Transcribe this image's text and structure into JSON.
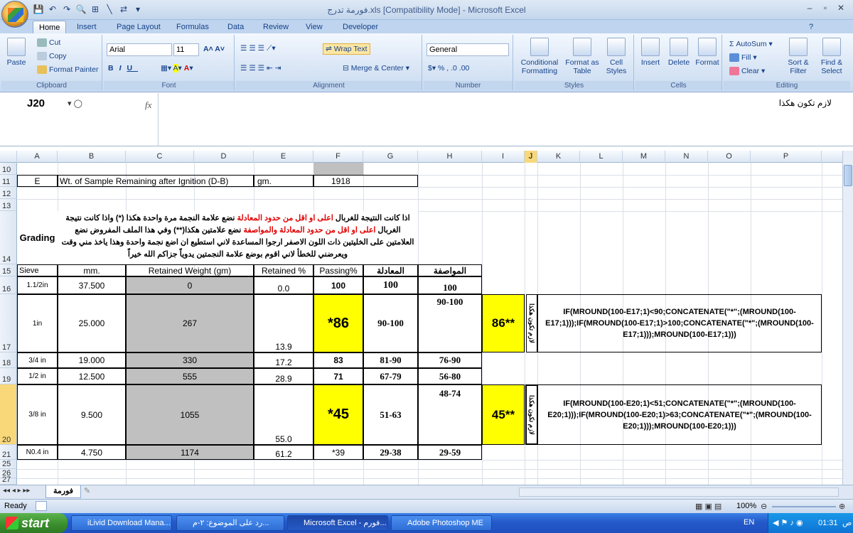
{
  "window": {
    "title": "فورمة تدرج.xls  [Compatibility Mode] - Microsoft Excel",
    "min": "–",
    "max": "▫",
    "close": "✕"
  },
  "ribbon_tabs": [
    "Home",
    "Insert",
    "Page Layout",
    "Formulas",
    "Data",
    "Review",
    "View",
    "Developer"
  ],
  "ribbon": {
    "clipboard": {
      "paste": "Paste",
      "cut": "Cut",
      "copy": "Copy",
      "format_painter": "Format Painter",
      "label": "Clipboard"
    },
    "font": {
      "name": "Arial",
      "size": "11",
      "label": "Font"
    },
    "alignment": {
      "wrap": "Wrap Text",
      "merge": "Merge & Center",
      "label": "Alignment"
    },
    "number": {
      "format": "General",
      "label": "Number"
    },
    "styles": {
      "conditional": "Conditional Formatting",
      "format_table": "Format as Table",
      "cell_styles": "Cell Styles",
      "label": "Styles"
    },
    "cells": {
      "insert": "Insert",
      "delete": "Delete",
      "format": "Format",
      "label": "Cells"
    },
    "editing": {
      "autosum": "AutoSum",
      "fill": "Fill",
      "clear": "Clear",
      "sort": "Sort & Filter",
      "find": "Find & Select",
      "label": "Editing"
    }
  },
  "formula_bar": {
    "name_box": "J20",
    "fx": "fx",
    "value": "لازم تكون هكذا"
  },
  "columns": [
    "A",
    "B",
    "C",
    "D",
    "E",
    "F",
    "G",
    "H",
    "I",
    "J",
    "K",
    "L",
    "M",
    "N",
    "O",
    "P"
  ],
  "rows": {
    "r11": {
      "a": "E",
      "b": "Wt. of Sample Remaining after Ignition (D-B)",
      "e": "gm.",
      "f": "1918"
    },
    "r14": {
      "grading": "Grading",
      "note_part1": "اذا كانت النتيجة للغربال ",
      "note_red1": "اعلى او اقل من حدود المعادلة",
      "note_part2": " نضع علامة النجمة مرة واحدة هكذا (*) واذا كانت نتيجة الغربال ",
      "note_red2": "اعلى او اقل من حدود المعادلة والمواصفة",
      "note_part3": " نضع علامتين هكذا(**)  وفي هذا الملف المفروض نضع العلامتين على الخليتين ذات اللون الاصفر ارجوا المساعدة لاني استطيع ان اضع نجمة واحدة وهذا ياخذ مني وقت ويعرضني للخطأ لاني اقوم بوضع علامة النجمتين يدوياً جزاكم الله خيراً"
    },
    "r15": {
      "sieve": "Sieve",
      "mm": "mm.",
      "retained_wt": "Retained Weight (gm)",
      "retained_pct": "Retained %",
      "passing": "Passing%",
      "equation": "المعادلة",
      "spec": "المواصفة"
    },
    "data": [
      {
        "row": "16",
        "sieve": "1.1/2in",
        "mm": "37.500",
        "wt": "0",
        "pct": "0.0",
        "pass": "100",
        "eq": "100",
        "spec": "100"
      },
      {
        "row": "17",
        "sieve": "1in",
        "mm": "25.000",
        "wt": "267",
        "pct": "13.9",
        "pass": "*86",
        "eq": "90-100",
        "spec": "90-100",
        "i": "86**",
        "j": "لازم تكون هكذا",
        "formula": "IF(MROUND(100-E17;1)<90;CONCATENATE(\"*\";(MROUND(100-E17;1)));IF(MROUND(100-E17;1)>100;CONCATENATE(\"*\";(MROUND(100-E17;1)));MROUND(100-E17;1)))"
      },
      {
        "row": "18",
        "sieve": "3/4 in",
        "mm": "19.000",
        "wt": "330",
        "pct": "17.2",
        "pass": "83",
        "eq": "81-90",
        "spec": "76-90"
      },
      {
        "row": "19",
        "sieve": "1/2 in",
        "mm": "12.500",
        "wt": "555",
        "pct": "28.9",
        "pass": "71",
        "eq": "67-79",
        "spec": "56-80"
      },
      {
        "row": "20",
        "sieve": "3/8 in",
        "mm": "9.500",
        "wt": "1055",
        "pct": "55.0",
        "pass": "*45",
        "eq": "51-63",
        "spec": "48-74",
        "i": "45**",
        "j": "لازم تكون هكذا",
        "formula": "IF(MROUND(100-E20;1)<51;CONCATENATE(\"*\";(MROUND(100-E20;1)));IF(MROUND(100-E20;1)>63;CONCATENATE(\"*\";(MROUND(100-E20;1)));MROUND(100-E20;1)))"
      },
      {
        "row": "21",
        "sieve": "N0.4 in",
        "mm": "4.750",
        "wt": "1174",
        "pct": "61.2",
        "pass": "*39",
        "eq": "29-38",
        "spec": "29-59"
      }
    ]
  },
  "row_numbers": [
    "10",
    "11",
    "12",
    "13",
    "14",
    "15",
    "16",
    "17",
    "18",
    "19",
    "20",
    "21",
    "25",
    "26",
    "27"
  ],
  "sheet_tab": "فورمة",
  "status": {
    "ready": "Ready",
    "zoom": "100%"
  },
  "taskbar": {
    "start": "start",
    "tasks": [
      "iLivid Download Mana...",
      "رد على الموضوع: ٢-م...",
      "Microsoft Excel - فورم...",
      "Adobe Photoshop ME"
    ],
    "lang": "EN",
    "time": "01:31",
    "ampm": "ص"
  }
}
